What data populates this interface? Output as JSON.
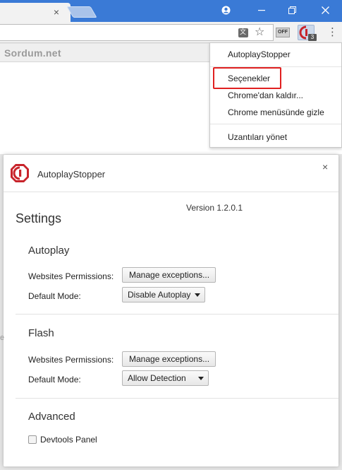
{
  "browser": {
    "tab_close_glyph": "×",
    "window_controls": {
      "profile_glyph": "●",
      "minimize_glyph": "–",
      "restore_glyph": "❐",
      "close_glyph": "✕"
    },
    "extensions": {
      "off_label": "OFF",
      "badge_count": "3"
    }
  },
  "page": {
    "site_name": "Sordum.net",
    "left_fragment": "e"
  },
  "context_menu": {
    "items": [
      {
        "label": "AutoplayStopper"
      },
      {
        "label": "Seçenekler",
        "highlighted": true
      },
      {
        "label": "Chrome'dan kaldır..."
      },
      {
        "label": "Chrome menüsünde gizle"
      },
      {
        "label": "Uzantıları yönet"
      }
    ],
    "highlight_color": "#e02020"
  },
  "dialog": {
    "title": "AutoplayStopper",
    "close_glyph": "×",
    "heading": "Settings",
    "version": "Version 1.2.0.1",
    "autoplay": {
      "title": "Autoplay",
      "permissions_label": "Websites Permissions:",
      "manage_button": "Manage exceptions...",
      "mode_label": "Default Mode:",
      "mode_value": "Disable Autoplay"
    },
    "flash": {
      "title": "Flash",
      "permissions_label": "Websites Permissions:",
      "manage_button": "Manage exceptions...",
      "mode_label": "Default Mode:",
      "mode_value": "Allow Detection"
    },
    "advanced": {
      "title": "Advanced",
      "devtools_label": "Devtools Panel",
      "devtools_checked": false
    }
  },
  "colors": {
    "titlebar": "#3a7ad6",
    "logo_red": "#c8242b"
  }
}
